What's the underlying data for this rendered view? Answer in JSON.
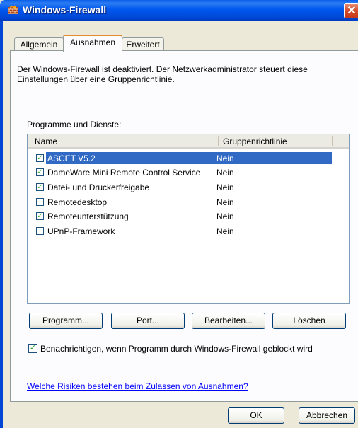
{
  "window": {
    "title": "Windows-Firewall",
    "close_glyph": "✕"
  },
  "tabs": [
    {
      "label": "Allgemein",
      "active": false
    },
    {
      "label": "Ausnahmen",
      "active": true
    },
    {
      "label": "Erweitert",
      "active": false
    }
  ],
  "description": "Der Windows-Firewall ist deaktiviert. Der Netzwerkadministrator steuert diese Einstellungen über eine Gruppenrichtlinie.",
  "programs": {
    "label": "Programme und Dienste:",
    "columns": {
      "name": "Name",
      "policy": "Gruppenrichtlinie"
    },
    "rows": [
      {
        "name": "ASCET V5.2",
        "policy": "Nein",
        "checked": true,
        "selected": true
      },
      {
        "name": "DameWare Mini Remote Control Service",
        "policy": "Nein",
        "checked": true,
        "selected": false
      },
      {
        "name": "Datei- und Druckerfreigabe",
        "policy": "Nein",
        "checked": true,
        "selected": false
      },
      {
        "name": "Remotedesktop",
        "policy": "Nein",
        "checked": false,
        "selected": false
      },
      {
        "name": "Remoteunterstützung",
        "policy": "Nein",
        "checked": true,
        "selected": false
      },
      {
        "name": "UPnP-Framework",
        "policy": "Nein",
        "checked": false,
        "selected": false
      }
    ]
  },
  "buttons": {
    "program": "Programm...",
    "port": "Port...",
    "edit": "Bearbeiten...",
    "delete": "Löschen"
  },
  "notify": {
    "label": "Benachrichtigen, wenn Programm durch Windows-Firewall geblockt wird",
    "checked": true
  },
  "help_link": "Welche Risiken bestehen beim Zulassen von Ausnahmen?",
  "footer": {
    "ok": "OK",
    "cancel": "Abbrechen"
  },
  "colors": {
    "selection": "#316AC5",
    "check": "#21A121",
    "link": "#0000FF",
    "titlebar": "#0058EE"
  }
}
